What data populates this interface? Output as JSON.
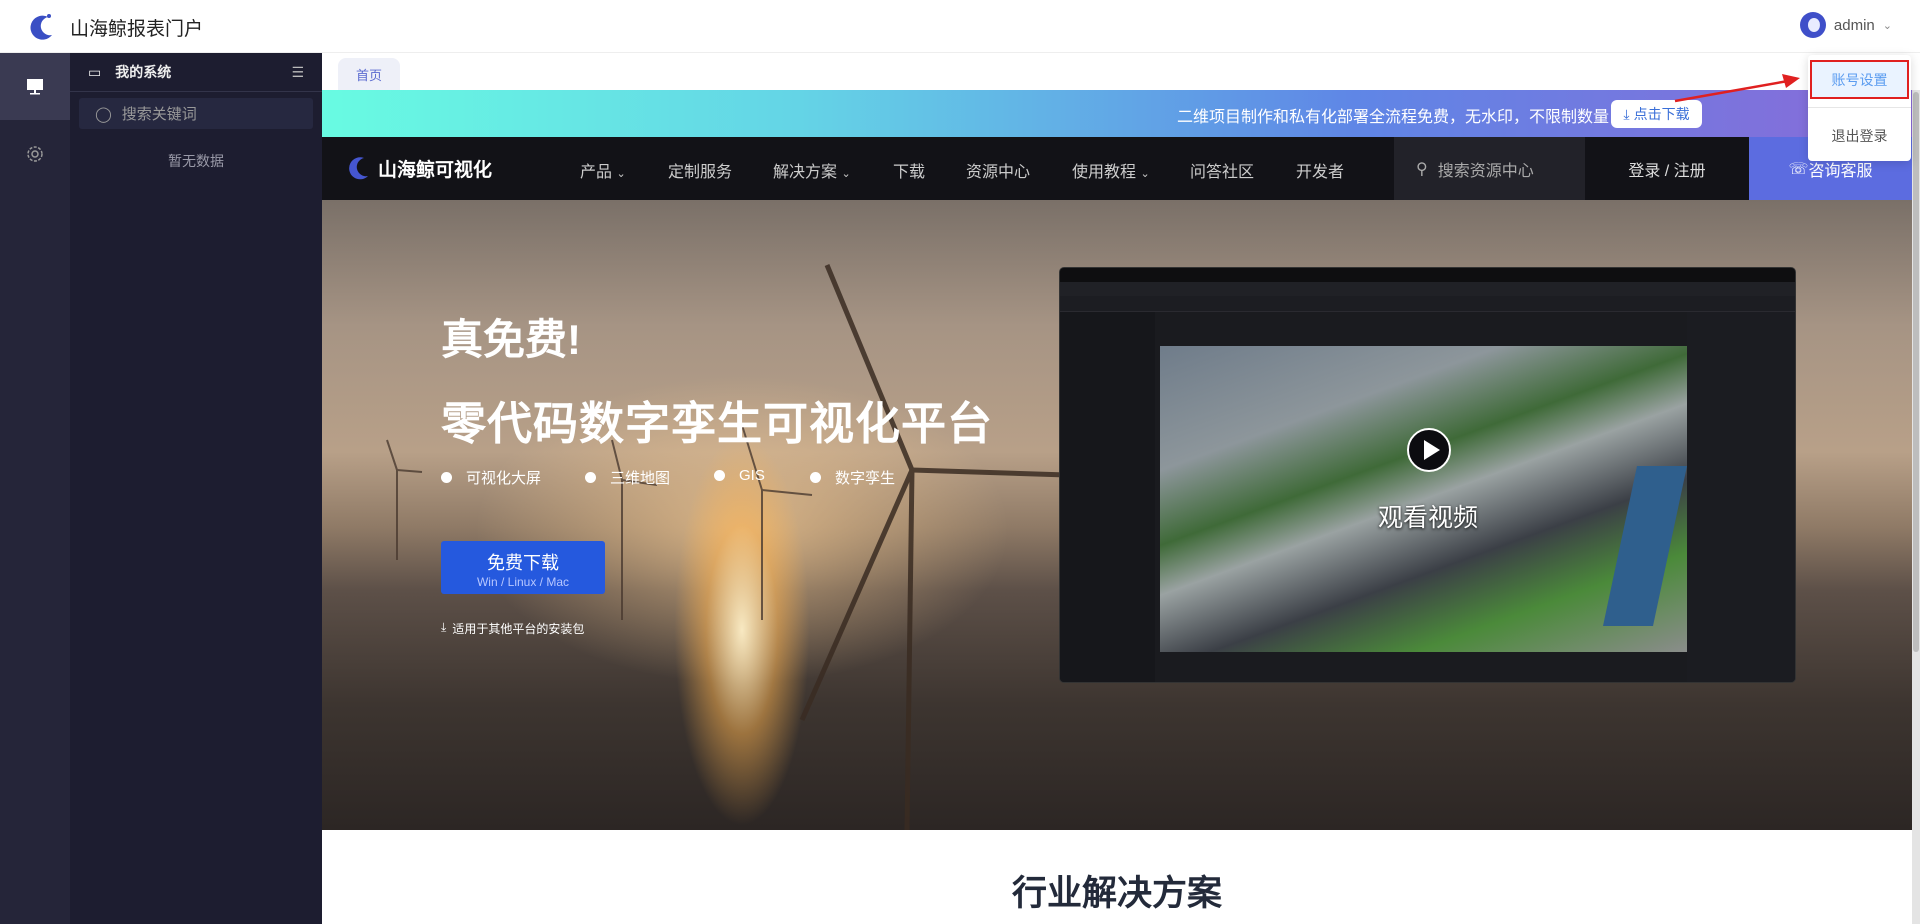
{
  "app": {
    "title": "山海鲸报表门户"
  },
  "user": {
    "name": "admin"
  },
  "user_menu": {
    "items": [
      "账号设置",
      "退出登录"
    ]
  },
  "sidebar": {
    "title": "我的系统",
    "search_placeholder": "搜索关键词",
    "empty": "暂无数据"
  },
  "tabs": [
    {
      "label": "首页",
      "active": true
    }
  ],
  "promo": {
    "text": "二维项目制作和私有化部署全流程免费，无水印，不限制数量",
    "button": "点击下载"
  },
  "site_nav": {
    "brand": "山海鲸可视化",
    "items": [
      "产品",
      "定制服务",
      "解决方案",
      "下载",
      "资源中心",
      "使用教程",
      "问答社区",
      "开发者"
    ],
    "search": "搜索资源中心",
    "login": "登录 / 注册",
    "consult": "咨询客服"
  },
  "hero": {
    "title1": "真免费!",
    "title2": "零代码数字孪生可视化平台",
    "features": [
      "可视化大屏",
      "三维地图",
      "GIS",
      "数字孪生"
    ],
    "download": "免费下载",
    "platforms": "Win / Linux / Mac",
    "other": "适用于其他平台的安装包",
    "watch_video": "观看视频"
  },
  "section": {
    "title": "行业解决方案"
  },
  "colors": {
    "accent": "#5c6ce0",
    "download": "#2559de",
    "highlight": "#e02020"
  }
}
